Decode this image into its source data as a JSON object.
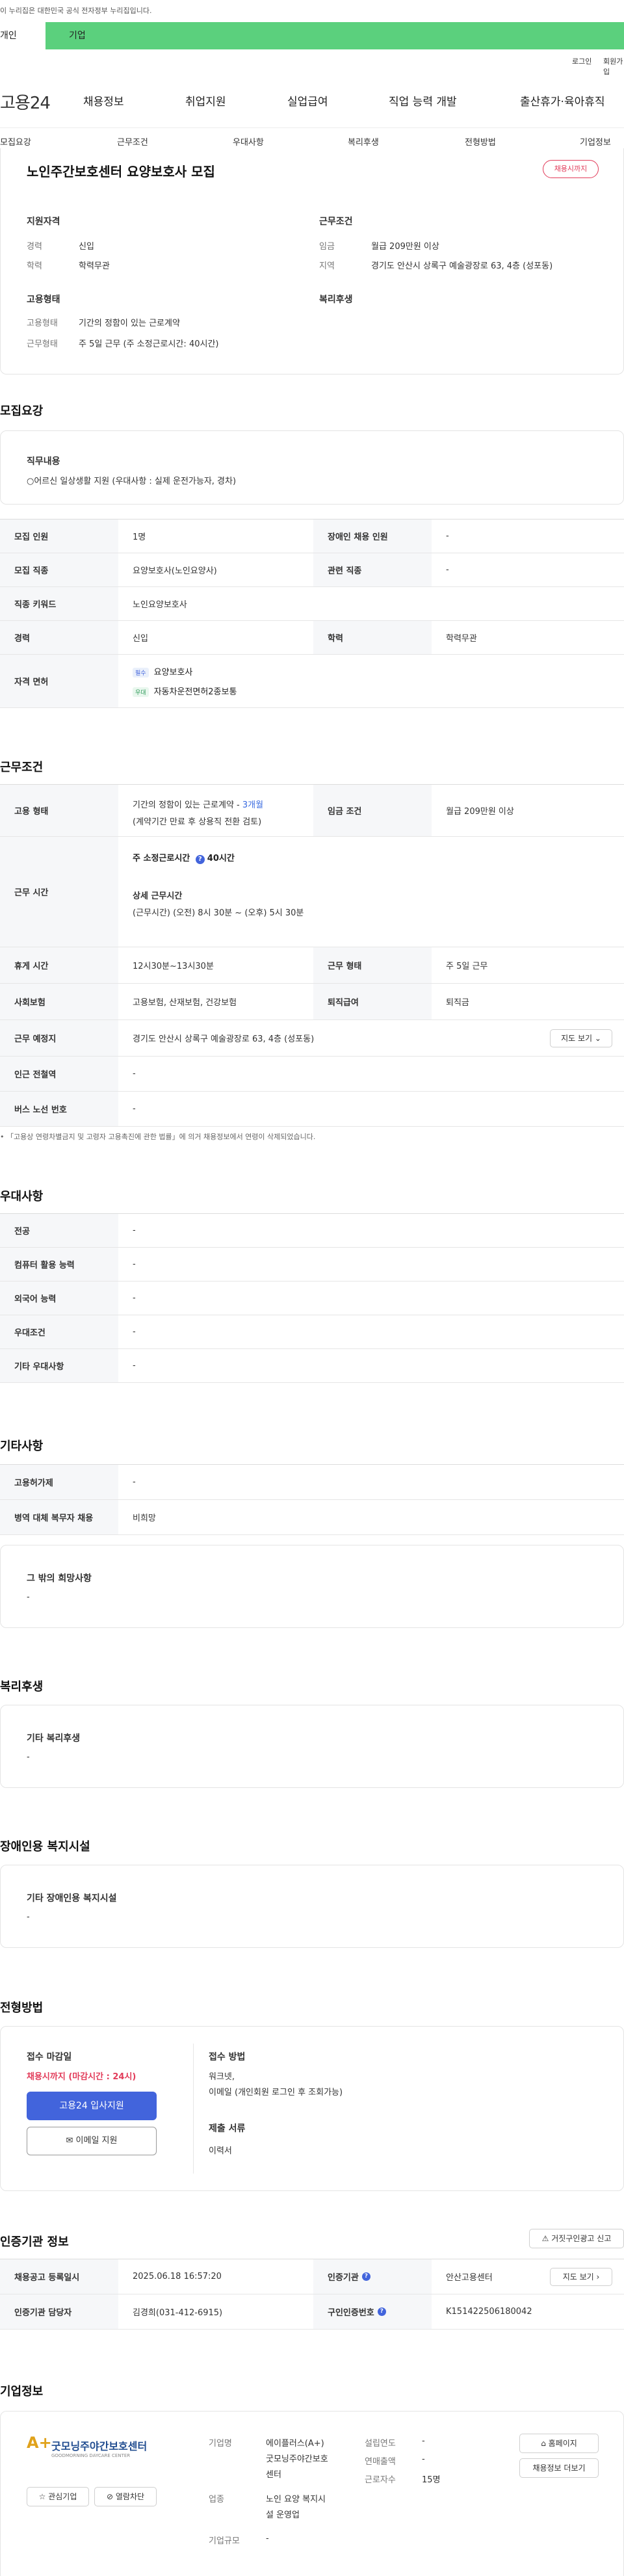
{
  "gov_notice": "이 누리집은 대한민국 공식 전자정부 누리집입니다.",
  "tabs": {
    "personal": "개인",
    "company": "기업"
  },
  "util": {
    "login": "로그인",
    "signup": "회원가입"
  },
  "logo": "고용24",
  "gnb": [
    "채용정보",
    "취업지원",
    "실업급여",
    "직업 능력 개발",
    "출산휴가·육아휴직"
  ],
  "snb": [
    "모집요강",
    "근무조건",
    "우대사항",
    "복리후생",
    "전형방법",
    "기업정보"
  ],
  "summary": {
    "title": "노인주간보호센터 요양보호사 모집",
    "badge": "채용시까지",
    "qual_title": "지원자격",
    "career_label": "경력",
    "career_value": "신입",
    "edu_label": "학력",
    "edu_value": "학력무관",
    "cond_title": "근무조건",
    "wage_label": "임금",
    "wage_value": "월급 209만원 이상",
    "area_label": "지역",
    "area_value": "경기도 안산시 상록구 예술광장로 63, 4층 (성포동)",
    "emp_title": "고용형태",
    "emptype_label": "고용형태",
    "emptype_value": "기간의 정함이 있는 근로계약",
    "worktype_label": "근무형태",
    "worktype_value": "주 5일 근무 (주 소정근로시간: 40시간)",
    "welfare_title": "복리후생"
  },
  "recruit": {
    "heading": "모집요강",
    "job_title": "직무내용",
    "job_value": "○어르신 일상생활 지원 (우대사항 : 실제 운전가능자, 경차)",
    "rows": {
      "count_label": "모집 인원",
      "count_value": "1명",
      "disabled_label": "장애인 채용 인원",
      "disabled_value": "-",
      "job_label": "모집 직종",
      "job_value": "요양보호사(노인요양사)",
      "related_label": "관련 직종",
      "related_value": "-",
      "keyword_label": "직종 키워드",
      "keyword_value": "노인요양보호사",
      "career_label": "경력",
      "career_value": "신입",
      "edu_label": "학력",
      "edu_value": "학력무관",
      "license_label": "자격 면허",
      "license1_tag": "필수",
      "license1": "요양보호사",
      "license2_tag": "우대",
      "license2": "자동차운전면허2종보통"
    }
  },
  "conditions": {
    "heading": "근무조건",
    "emp_label": "고용 형태",
    "emp_value_a": "기간의 정함이 있는 근로계약 - ",
    "emp_value_b": "3개월",
    "emp_value_c": "(계약기간 만료 후 상용직 전환 검토)",
    "wage_label": "임금 조건",
    "wage_value": "월급 209만원 이상",
    "hours_label": "근무 시간",
    "weekly_label": "주 소정근로시간",
    "weekly_value": "40시간",
    "detail_label": "상세 근무시간",
    "detail_value": "(근무시간) (오전) 8시 30분 ~ (오후) 5시 30분",
    "break_label": "휴게 시간",
    "break_value": "12시30분~13시30분",
    "worktype_label": "근무 형태",
    "worktype_value": "주 5일 근무",
    "insurance_label": "사회보험",
    "insurance_value": "고용보험, 산재보험, 건강보험",
    "severance_label": "퇴직급여",
    "severance_value": "퇴직금",
    "place_label": "근무 예정지",
    "place_value": "경기도 안산시 상록구 예술광장로 63, 4층 (성포동)",
    "map_btn": "지도 보기",
    "station_label": "인근 전철역",
    "station_value": "-",
    "bus_label": "버스 노선 번호",
    "bus_value": "-",
    "note": "「고용상 연령차별금지 및 고령자 고용촉진에 관한 법률」에 의거 채용정보에서 연령이 삭제되었습니다."
  },
  "preferences": {
    "heading": "우대사항",
    "major_label": "전공",
    "major_value": "-",
    "computer_label": "컴퓨터 활용 능력",
    "computer_value": "-",
    "lang_label": "외국어 능력",
    "lang_value": "-",
    "cond_label": "우대조건",
    "cond_value": "-",
    "etc_label": "기타 우대사항",
    "etc_value": "-"
  },
  "others": {
    "heading": "기타사항",
    "contract_label": "고용허가제",
    "contract_value": "-",
    "military_label": "병역 대체 복무자 채용",
    "military_value": "비희망",
    "wish_title": "그 밖의 희망사항",
    "wish_value": "-"
  },
  "welfare": {
    "heading": "복리후생",
    "title": "기타 복리후생",
    "value": "-"
  },
  "disabled": {
    "heading": "장애인용 복지시설",
    "title": "기타 장애인용 복지시설",
    "value": "-"
  },
  "selection": {
    "heading": "전형방법",
    "deadline_title": "접수 마감일",
    "deadline_value": "채용시까지 (마감시간 : 24시)",
    "apply_btn": "고용24 입사지원",
    "email_btn": "이메일 지원",
    "method_title": "접수 방법",
    "method_value": "워크넷,",
    "method_value2": "이메일 (개인회원 로그인 후 조회가능)",
    "docs_title": "제출 서류",
    "docs_value": "이력서"
  },
  "certification": {
    "heading": "인증기관 정보",
    "report_btn": "거짓구인광고 신고",
    "reg_label": "채용공고 등록일시",
    "reg_value": "2025.06.18 16:57:20",
    "agency_label": "인증기관",
    "agency_value": "안산고용센터",
    "dir_btn": "지도 보기",
    "manager_label": "인증기관 담당자",
    "manager_value": "김경희(031-412-6915)",
    "num_label": "구인인증번호",
    "num_value": "K151422506180042"
  },
  "company": {
    "heading": "기업정보",
    "logo_text": "굿모닝주야간보호센터",
    "logo_sub": "GOODMORNING DAYCARE CENTER",
    "logo_mark": "A+",
    "fav_btn": "관심기업",
    "block_btn": "열람차단",
    "name_label": "기업명",
    "name_value1": "에이플러스(A+)",
    "name_value2": "굿모닝주야간보호",
    "name_value3": "센터",
    "industry_label": "업종",
    "industry_value1": "노인 요양 복지시",
    "industry_value2": "설 운영업",
    "size_label": "기업규모",
    "size_value": "-",
    "year_label": "설립연도",
    "year_value": "-",
    "sales_label": "연매출액",
    "sales_value": "-",
    "emp_label": "근로자수",
    "emp_value": "15명",
    "home_btn": "홈페이지",
    "recruit_btn": "채용정보 더보기"
  },
  "colors": {
    "accent": "#5bd07d",
    "primary": "#4264dc",
    "danger": "#e23c5a"
  }
}
